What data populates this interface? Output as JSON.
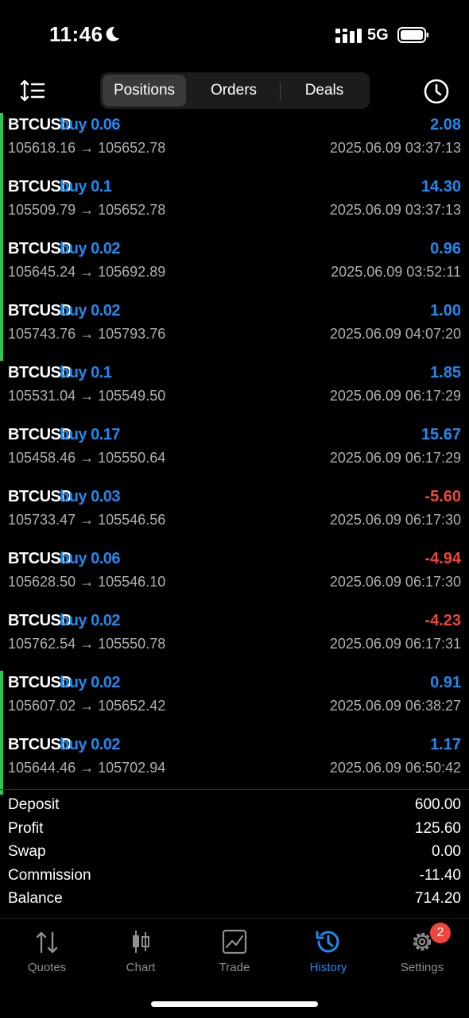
{
  "status": {
    "time": "11:46",
    "network": "5G"
  },
  "toolbar": {
    "segments": [
      "Positions",
      "Orders",
      "Deals"
    ]
  },
  "deals": [
    {
      "symbol": "BTCUSD",
      "side": "buy 0.06",
      "open": "105618.16",
      "arrow": "→",
      "close": "105652.78",
      "datetime": "2025.06.09 03:37:13",
      "profit": "2.08",
      "sign": "pos",
      "bar": true
    },
    {
      "symbol": "BTCUSD",
      "side": "buy 0.1",
      "open": "105509.79",
      "arrow": "→",
      "close": "105652.78",
      "datetime": "2025.06.09 03:37:13",
      "profit": "14.30",
      "sign": "pos",
      "bar": true
    },
    {
      "symbol": "BTCUSD",
      "side": "buy 0.02",
      "open": "105645.24",
      "arrow": "→",
      "close": "105692.89",
      "datetime": "2025.06.09 03:52:11",
      "profit": "0.96",
      "sign": "pos",
      "bar": true
    },
    {
      "symbol": "BTCUSD",
      "side": "buy 0.02",
      "open": "105743.76",
      "arrow": "→",
      "close": "105793.76",
      "datetime": "2025.06.09 04:07:20",
      "profit": "1.00",
      "sign": "pos",
      "bar": true
    },
    {
      "symbol": "BTCUSD",
      "side": "buy 0.1",
      "open": "105531.04",
      "arrow": "→",
      "close": "105549.50",
      "datetime": "2025.06.09 06:17:29",
      "profit": "1.85",
      "sign": "pos",
      "bar": false
    },
    {
      "symbol": "BTCUSD",
      "side": "buy 0.17",
      "open": "105458.46",
      "arrow": "→",
      "close": "105550.64",
      "datetime": "2025.06.09 06:17:29",
      "profit": "15.67",
      "sign": "pos",
      "bar": false
    },
    {
      "symbol": "BTCUSD",
      "side": "buy 0.03",
      "open": "105733.47",
      "arrow": "→",
      "close": "105546.56",
      "datetime": "2025.06.09 06:17:30",
      "profit": "-5.60",
      "sign": "neg",
      "bar": false
    },
    {
      "symbol": "BTCUSD",
      "side": "buy 0.06",
      "open": "105628.50",
      "arrow": "→",
      "close": "105546.10",
      "datetime": "2025.06.09 06:17:30",
      "profit": "-4.94",
      "sign": "neg",
      "bar": false
    },
    {
      "symbol": "BTCUSD",
      "side": "buy 0.02",
      "open": "105762.54",
      "arrow": "→",
      "close": "105550.78",
      "datetime": "2025.06.09 06:17:31",
      "profit": "-4.23",
      "sign": "neg",
      "bar": false
    },
    {
      "symbol": "BTCUSD",
      "side": "buy 0.02",
      "open": "105607.02",
      "arrow": "→",
      "close": "105652.42",
      "datetime": "2025.06.09 06:38:27",
      "profit": "0.91",
      "sign": "pos",
      "bar": true
    },
    {
      "symbol": "BTCUSD",
      "side": "buy 0.02",
      "open": "105644.46",
      "arrow": "→",
      "close": "105702.94",
      "datetime": "2025.06.09 06:50:42",
      "profit": "1.17",
      "sign": "pos",
      "bar": true
    }
  ],
  "summary": [
    {
      "label": "Deposit",
      "value": "600.00"
    },
    {
      "label": "Profit",
      "value": "125.60"
    },
    {
      "label": "Swap",
      "value": "0.00"
    },
    {
      "label": "Commission",
      "value": "-11.40"
    },
    {
      "label": "Balance",
      "value": "714.20"
    }
  ],
  "tabs": [
    {
      "label": "Quotes",
      "icon": "quotes-icon"
    },
    {
      "label": "Chart",
      "icon": "candlestick-icon"
    },
    {
      "label": "Trade",
      "icon": "trade-icon"
    },
    {
      "label": "History",
      "icon": "history-icon",
      "active": true
    },
    {
      "label": "Settings",
      "icon": "gear-icon"
    }
  ],
  "settings_badge": "2",
  "colors": {
    "accent": "#1f8af2",
    "negative": "#f0463c",
    "bar_green": "#30c54f"
  }
}
